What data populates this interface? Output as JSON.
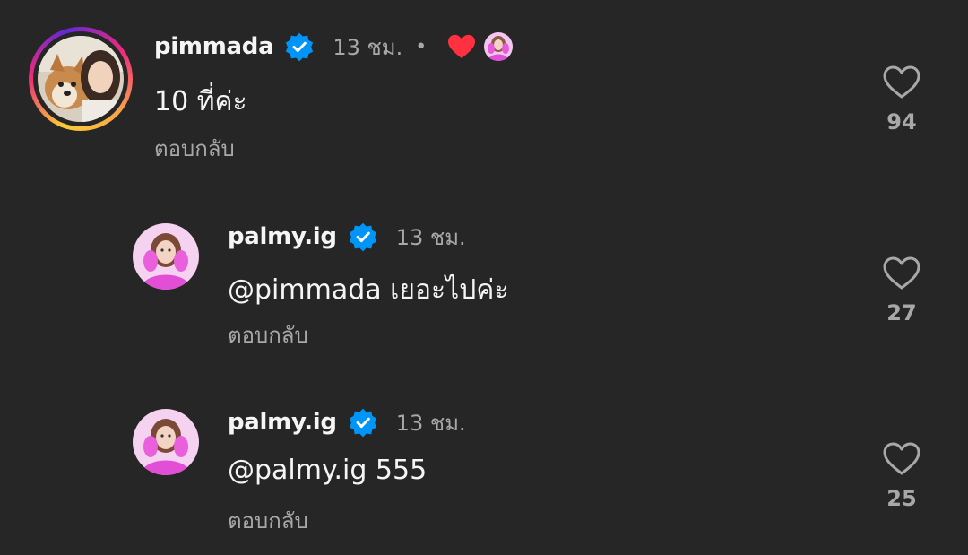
{
  "comments": [
    {
      "username": "pimmada",
      "time": "13 ชม.",
      "separator": "•",
      "text": "10 ที่ค่ะ",
      "reply_label": "ตอบกลับ",
      "likes": "94",
      "verified": true,
      "author_liked": true
    },
    {
      "username": "palmy.ig",
      "time": "13 ชม.",
      "text": "@pimmada เยอะไปค่ะ",
      "reply_label": "ตอบกลับ",
      "likes": "27",
      "verified": true
    },
    {
      "username": "palmy.ig",
      "time": "13 ชม.",
      "text": "@palmy.ig 555",
      "reply_label": "ตอบกลับ",
      "likes": "25",
      "verified": true
    }
  ],
  "colors": {
    "background": "#262626",
    "verified_blue": "#0095f6",
    "heart_red": "#ff3040",
    "secondary_text": "#a8a8a8"
  },
  "icons": {
    "verified": "verified-badge-icon",
    "like": "heart-outline-icon",
    "author_like": "heart-filled-icon"
  }
}
